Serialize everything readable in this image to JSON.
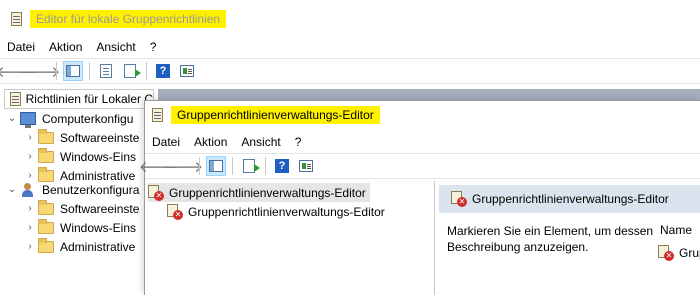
{
  "back_window": {
    "title": "Editor für lokale Gruppenrichtlinien",
    "menu": [
      "Datei",
      "Aktion",
      "Ansicht",
      "?"
    ],
    "tree_header": "Richtlinien für Lokaler C",
    "tree": [
      {
        "label": "Computerkonfigu",
        "icon": "computer-icon",
        "expanded": true
      },
      {
        "label": "Softwareeinste",
        "icon": "folder-icon"
      },
      {
        "label": "Windows-Eins",
        "icon": "folder-icon"
      },
      {
        "label": "Administrative",
        "icon": "folder-icon"
      },
      {
        "label": "Benutzerkonfigura",
        "icon": "user-icon",
        "expanded": true
      },
      {
        "label": "Softwareeinste",
        "icon": "folder-icon"
      },
      {
        "label": "Windows-Eins",
        "icon": "folder-icon"
      },
      {
        "label": "Administrative",
        "icon": "folder-icon"
      }
    ]
  },
  "front_window": {
    "title": "Gruppenrichtlinienverwaltungs-Editor",
    "menu": [
      "Datei",
      "Aktion",
      "Ansicht",
      "?"
    ],
    "tree": [
      {
        "label": "Gruppenrichtlinienverwaltungs-Editor",
        "icon": "error-snapin-icon"
      },
      {
        "label": "Gruppenrichtlinienverwaltungs-Editor",
        "icon": "error-snapin-icon"
      }
    ],
    "panel_title": "Gruppenrichtlinienverwaltungs-Editor",
    "description_line1": "Markieren Sie ein Element, um dessen",
    "description_line2": "Beschreibung anzuzeigen.",
    "column_header": "Name",
    "list_item": "Grup"
  },
  "colors": {
    "highlight": "#fff000",
    "panel_header": "#dbe3ee",
    "toolbar_active": "#cce8ff"
  }
}
